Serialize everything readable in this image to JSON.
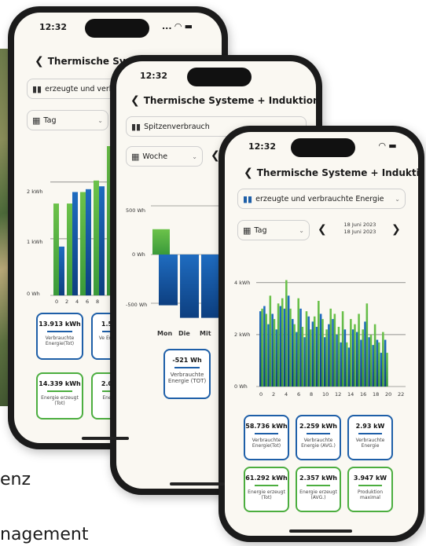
{
  "background": {
    "text1": "enz",
    "text2": "nagement"
  },
  "phone1": {
    "time": "12:32",
    "status": "... ◠ ▬",
    "title": "Thermische Syste",
    "metric": "erzeugte und verb",
    "period": "Tag",
    "y_labels": [
      "2 kWh",
      "1 kWh",
      "0 Wh"
    ],
    "x_labels": [
      "0",
      "2",
      "4",
      "6",
      "8"
    ],
    "cards": [
      {
        "value": "13.913 kWh",
        "label": "Verbrauchte Energie(Tot)"
      },
      {
        "value": "1.5",
        "label": "Ve Ene"
      },
      {
        "value": "14.339 kWh",
        "label": "Energie erzeugt (Tot)"
      },
      {
        "value": "2.0",
        "label": "Ene"
      }
    ]
  },
  "phone2": {
    "time": "12:32",
    "title": "Thermische Systeme + Induktion",
    "metric": "Spitzenverbrauch",
    "period": "Woche",
    "y_labels": [
      "500 Wh",
      "0 Wh",
      "-500 Wh"
    ],
    "x_labels": [
      "Mon",
      "Die",
      "Mit"
    ],
    "card": {
      "value": "-521 Wh",
      "label": "Verbrauchte Energie (TOT)"
    }
  },
  "phone3": {
    "time": "12:32",
    "title": "Thermische Systeme + Induktion",
    "metric": "erzeugte und verbrauchte Energie",
    "period": "Tag",
    "date_from": "18 Juni 2023",
    "date_to": "18 Juni 2023",
    "cards": [
      {
        "value": "58.736 kWh",
        "label": "Verbrauchte Energie(Tot)"
      },
      {
        "value": "2.259 kWh",
        "label": "Verbrauchte Energie (AVG.)"
      },
      {
        "value": "2.93 kW",
        "label": "Verbrauchte Energie"
      },
      {
        "value": "61.292 kWh",
        "label": "Energie erzeugt (Tot)"
      },
      {
        "value": "2.357 kWh",
        "label": "Energie erzeugt (AVG.)"
      },
      {
        "value": "3.947 kW",
        "label": "Produktion maximal"
      }
    ]
  },
  "chart_data": [
    {
      "type": "bar",
      "ylim": [
        0,
        2.6
      ],
      "x_tick_labels": [
        "0",
        "2",
        "4",
        "6",
        "8"
      ],
      "series": [
        {
          "values": [
            0.85,
            1.8,
            1.85,
            1.9,
            2.7
          ]
        },
        {
          "values": [
            1.6,
            1.6,
            1.8,
            2.0,
            2.6
          ]
        }
      ]
    },
    {
      "type": "bar",
      "categories": [
        "Mon",
        "Die",
        "Mit"
      ],
      "ylim": [
        -700,
        600
      ],
      "values": [
        -521,
        -650,
        -650
      ],
      "top_segment": [
        260,
        0,
        0
      ]
    },
    {
      "type": "bar",
      "ylim": [
        0,
        4.6
      ],
      "x_tick_labels": [
        "0",
        "2",
        "4",
        "6",
        "8",
        "10",
        "12",
        "14",
        "16",
        "18",
        "20",
        "22"
      ],
      "series": [
        {
          "values": [
            2.9,
            3.1,
            2.4,
            2.8,
            2.2,
            3.1,
            3.0,
            3.5,
            2.6,
            2.1,
            3.0,
            1.9,
            2.7,
            2.5,
            2.3,
            2.8,
            1.9,
            2.4,
            2.6,
            2.0,
            1.7,
            2.2,
            1.5,
            2.2,
            2.1,
            1.8,
            2.5,
            1.9,
            1.6,
            1.8,
            1.3,
            1.8
          ]
        },
        {
          "values": [
            3.0,
            2.8,
            3.5,
            2.6,
            3.2,
            3.4,
            4.1,
            3.0,
            2.4,
            3.4,
            2.3,
            2.9,
            2.2,
            2.7,
            3.3,
            2.6,
            2.2,
            3.0,
            2.8,
            2.3,
            2.9,
            1.7,
            2.6,
            2.4,
            2.8,
            2.2,
            3.2,
            2.0,
            2.4,
            1.7,
            2.1,
            1.3
          ]
        }
      ]
    }
  ]
}
